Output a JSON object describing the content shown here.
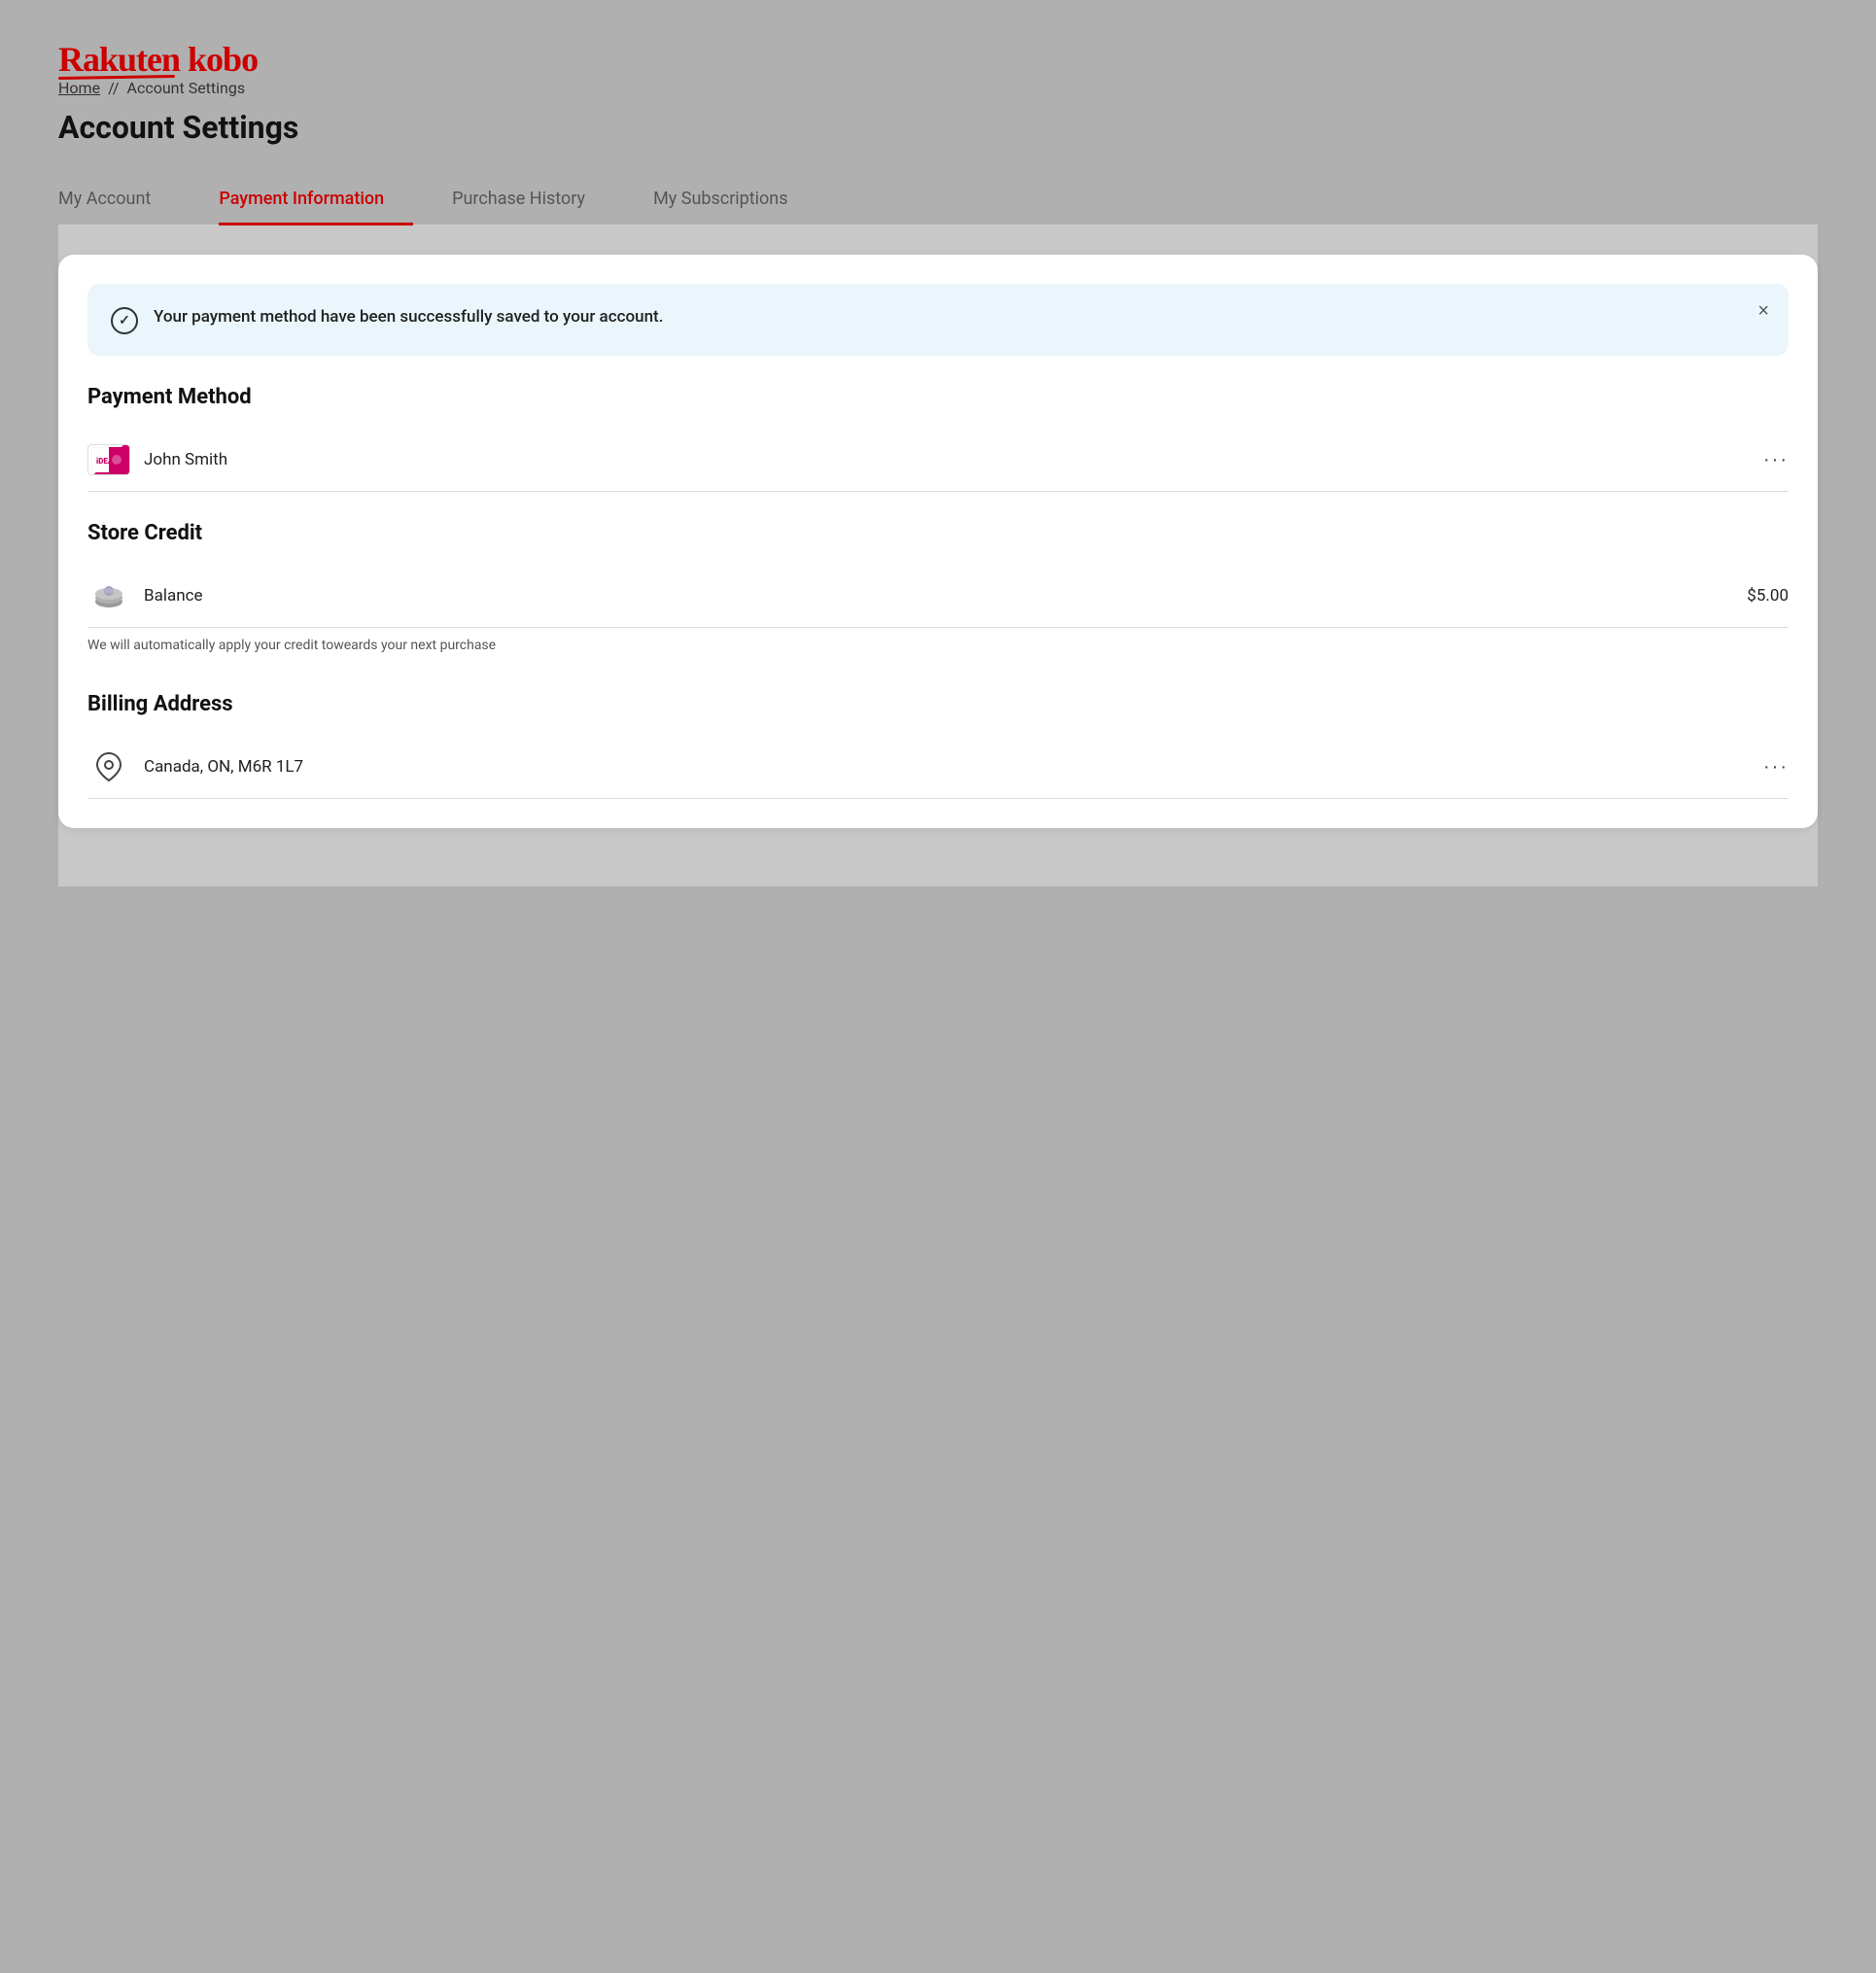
{
  "logo": {
    "text": "Rakuten kobo"
  },
  "breadcrumb": {
    "home": "Home",
    "separator": "//",
    "current": "Account Settings"
  },
  "page_title": "Account Settings",
  "tabs": [
    {
      "id": "my-account",
      "label": "My Account",
      "active": false
    },
    {
      "id": "payment-information",
      "label": "Payment Information",
      "active": true
    },
    {
      "id": "purchase-history",
      "label": "Purchase History",
      "active": false
    },
    {
      "id": "my-subscriptions",
      "label": "My Subscriptions",
      "active": false
    }
  ],
  "success_banner": {
    "message": "Your payment method have been successfully saved to your account.",
    "close_label": "×"
  },
  "payment_method": {
    "section_title": "Payment Method",
    "name": "John Smith",
    "more_label": "···"
  },
  "store_credit": {
    "section_title": "Store Credit",
    "label": "Balance",
    "balance": "$5.00",
    "note": "We will automatically apply your credit toweards your next purchase",
    "more_label": "···"
  },
  "billing_address": {
    "section_title": "Billing Address",
    "address": "Canada, ON, M6R 1L7",
    "more_label": "···"
  }
}
